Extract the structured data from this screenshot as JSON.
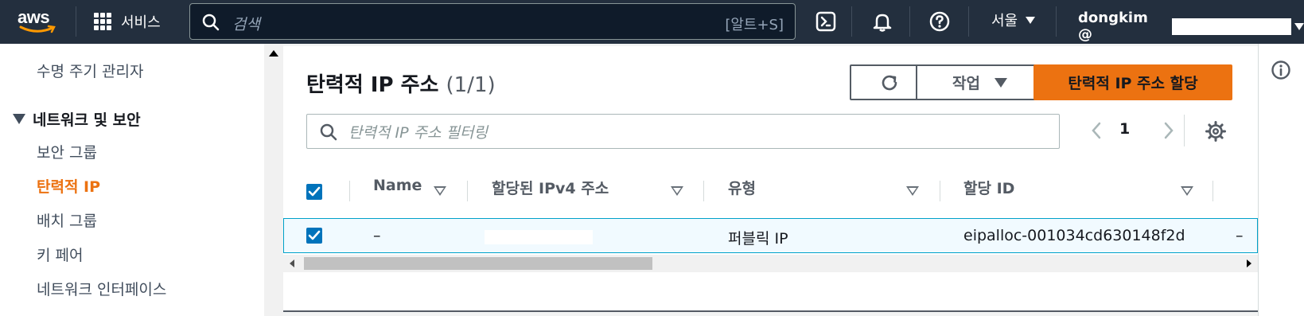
{
  "topbar": {
    "logo": "aws",
    "services_label": "서비스",
    "search_placeholder": "검색",
    "search_shortcut": "[알트+S]",
    "region": "서울",
    "user": "dongkim @"
  },
  "sidebar": {
    "items_top": [
      "수명 주기 관리자"
    ],
    "section": "네트워크 및 보안",
    "items": [
      "보안 그룹",
      "탄력적 IP",
      "배치 그룹",
      "키 페어",
      "네트워크 인터페이스"
    ],
    "active": "탄력적 IP"
  },
  "main": {
    "title": "탄력적 IP 주소",
    "count": "(1/1)",
    "actions_label": "작업",
    "allocate_label": "탄력적 IP 주소 할당",
    "filter_placeholder": "탄력적 IP 주소 필터링",
    "page_number": "1"
  },
  "table": {
    "columns": [
      "Name",
      "할당된 IPv4 주소",
      "유형",
      "할당 ID"
    ],
    "rows": [
      {
        "name": "–",
        "type": "퍼블릭 IP",
        "allocation_id": "eipalloc-001034cd630148f2d",
        "extra": "–"
      }
    ]
  },
  "colors": {
    "topbar": "#232f3e",
    "accent": "#ec7211",
    "primary_btn": "#ec7211",
    "selection": "#0073bb"
  }
}
